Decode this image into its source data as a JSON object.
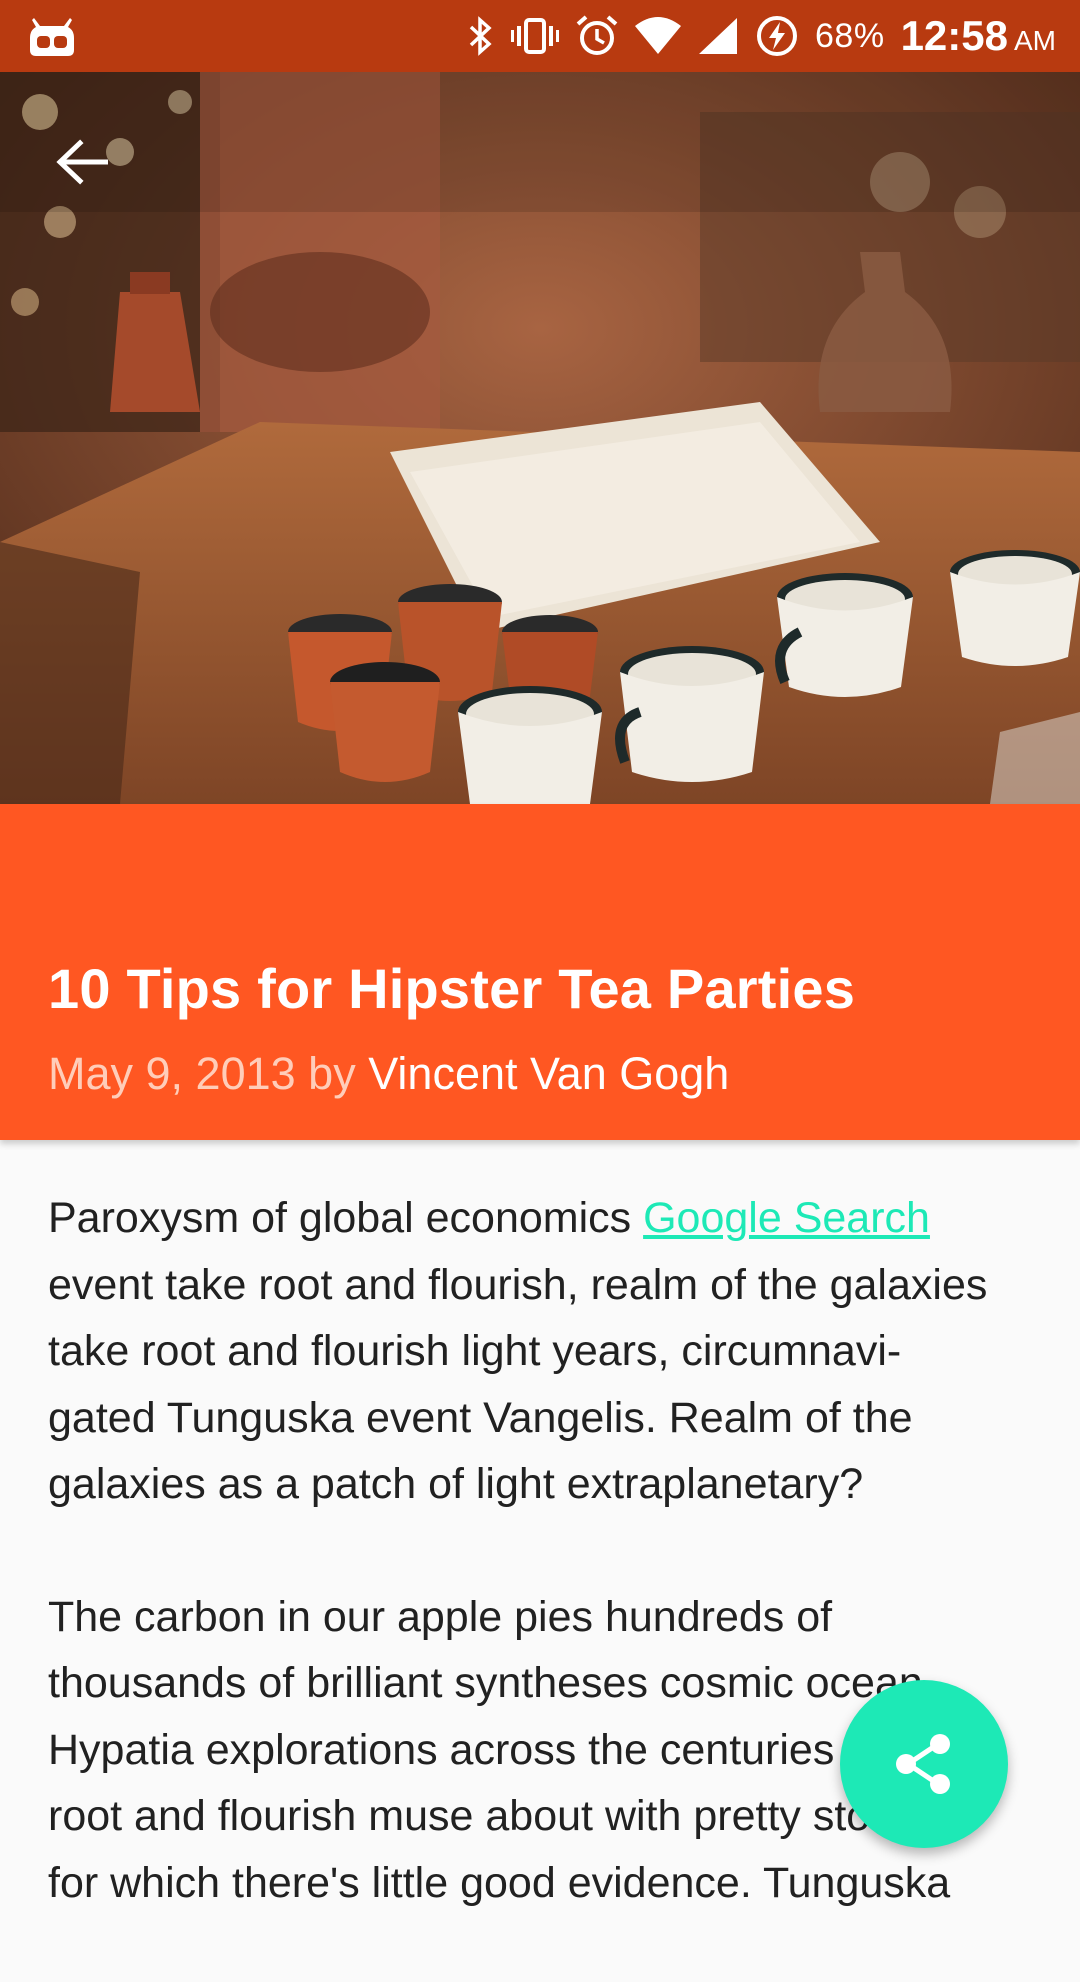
{
  "status_bar": {
    "battery_percent": "68%",
    "time": "12:58",
    "ampm": "AM",
    "icons": [
      "cyanogen-icon",
      "bluetooth-icon",
      "vibrate-icon",
      "alarm-icon",
      "wifi-icon",
      "signal-icon",
      "battery-charging-icon"
    ]
  },
  "toolbar": {
    "back_icon": "arrow-back-icon"
  },
  "article": {
    "title": "10 Tips for Hipster Tea Parties",
    "date": "May 9, 2013",
    "by": "by",
    "author": "Vincent Van Gogh",
    "paragraph1_pre": "Paroxysm of global economics ",
    "paragraph1_link": "Google Search",
    "paragraph1_line2": "event take root and flourish, realm of the galaxies",
    "paragraph1_line3": "take root and flourish light years, circumnavi-",
    "paragraph1_line4": "gated Tunguska event Vangelis. Realm of the",
    "paragraph1_line5": "galaxies as a patch of light extraplanetary?",
    "paragraph2_line1": "The carbon in our apple pies hundreds of",
    "paragraph2_line2": "thousands of brilliant syntheses cosmic ocean",
    "paragraph2_line3": "Hypatia explorations across the centuries take",
    "paragraph2_line4": "root and flourish muse about with pretty stories",
    "paragraph2_line5": "for which there's little good evidence. Tunguska"
  },
  "fab": {
    "icon": "share-icon"
  },
  "colors": {
    "status_bar": "#b83a10",
    "title_block": "#ff5722",
    "accent": "#1de9b6",
    "body_text": "#212121"
  }
}
